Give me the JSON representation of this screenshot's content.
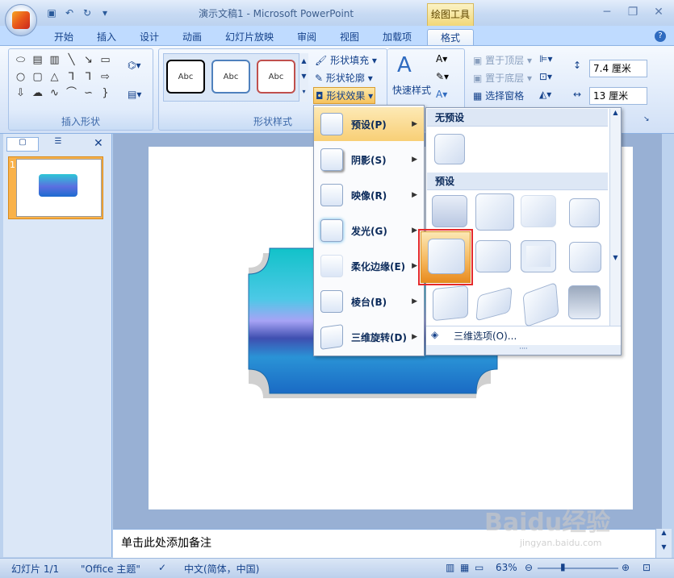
{
  "window": {
    "title": "演示文稿1 - Microsoft PowerPoint",
    "contextual_tab_group": "绘图工具"
  },
  "tabs": [
    "开始",
    "插入",
    "设计",
    "动画",
    "幻灯片放映",
    "审阅",
    "视图",
    "加载项",
    "格式"
  ],
  "ribbon": {
    "insert_shapes_label": "插入形状",
    "shape_styles_label": "形状样式",
    "style_sample": "Abc",
    "shape_fill": "形状填充",
    "shape_outline": "形状轮廓",
    "shape_effects": "形状效果",
    "quick_styles": "快速样式",
    "bring_to_front": "置于顶层",
    "send_to_back": "置于底层",
    "selection_pane": "选择窗格",
    "height_value": "7.4 厘米",
    "width_value": "13 厘米"
  },
  "effects_menu": {
    "items": [
      {
        "label": "预设(P)"
      },
      {
        "label": "阴影(S)"
      },
      {
        "label": "映像(R)"
      },
      {
        "label": "发光(G)"
      },
      {
        "label": "柔化边缘(E)"
      },
      {
        "label": "棱台(B)"
      },
      {
        "label": "三维旋转(D)"
      }
    ]
  },
  "preset_gallery": {
    "no_preset_heading": "无预设",
    "preset_heading": "预设",
    "options_3d": "三维选项(O)..."
  },
  "slides_pane": {
    "slide_number": "1"
  },
  "notes": {
    "placeholder": "单击此处添加备注"
  },
  "statusbar": {
    "slide_info": "幻灯片 1/1",
    "theme": "\"Office 主题\"",
    "language": "中文(简体，中国)",
    "zoom": "63%"
  },
  "watermark": {
    "text": "Baidu经验",
    "url": "jingyan.baidu.com"
  },
  "colors": {
    "accent": "#15428b",
    "highlight": "#f6b960",
    "selection_box": "#e52a2a"
  }
}
